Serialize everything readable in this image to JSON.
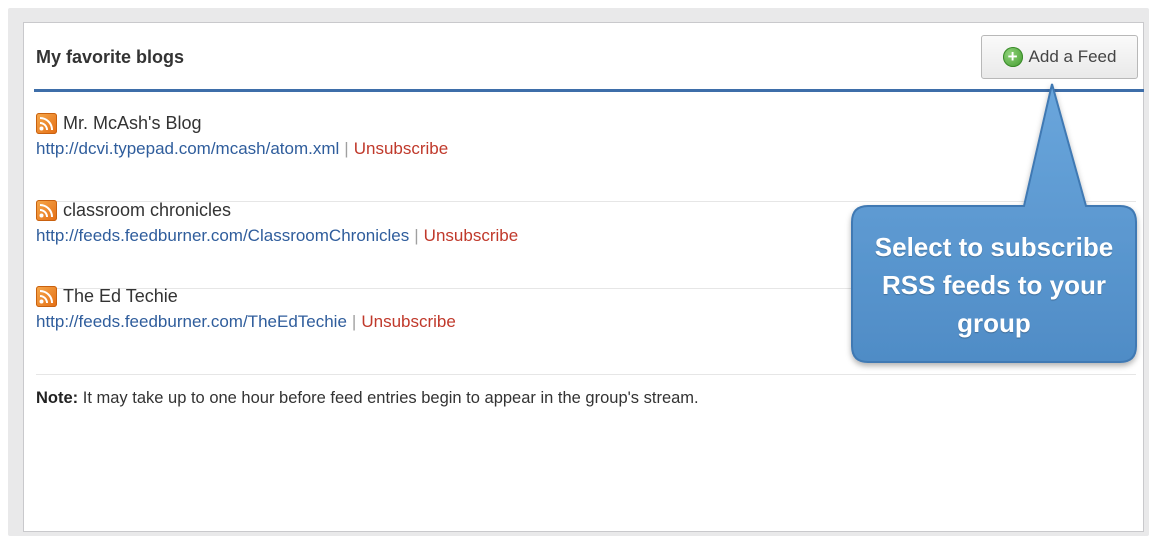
{
  "panel": {
    "title": "My favorite blogs",
    "add_button_label": "Add a Feed"
  },
  "feeds": [
    {
      "name": "Mr. McAsh's Blog",
      "url": "http://dcvi.typepad.com/mcash/atom.xml",
      "separator": "|",
      "action": "Unsubscribe"
    },
    {
      "name": "classroom chronicles",
      "url": "http://feeds.feedburner.com/ClassroomChronicles",
      "separator": "|",
      "action": "Unsubscribe"
    },
    {
      "name": "The Ed Techie",
      "url": "http://feeds.feedburner.com/TheEdTechie",
      "separator": "|",
      "action": "Unsubscribe"
    }
  ],
  "note": {
    "label": "Note:",
    "text": " It may take up to one hour before feed entries begin to appear in the group's stream."
  },
  "callout": {
    "lines": [
      "Select to subscribe",
      "RSS feeds to your",
      "group"
    ]
  },
  "colors": {
    "header_rule": "#3e6ea9",
    "link": "#2f5d9c",
    "unsubscribe": "#c0392b",
    "callout_fill": "#5b9bd5"
  },
  "icons": {
    "feed": "rss-icon",
    "add": "plus-circle-icon"
  }
}
